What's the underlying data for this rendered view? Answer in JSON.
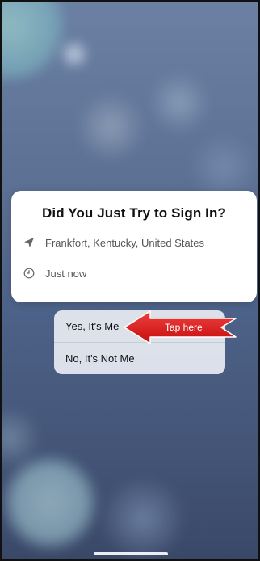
{
  "signin_prompt": {
    "title": "Did You Just Try to Sign In?",
    "location": {
      "icon": "location-arrow-icon",
      "text": "Frankfort, Kentucky, United States"
    },
    "time": {
      "icon": "clock-icon",
      "text": "Just now"
    }
  },
  "action_menu": {
    "items": [
      {
        "label": "Yes, It's Me"
      },
      {
        "label": "No, It's Not Me"
      }
    ]
  },
  "callout": {
    "text": "Tap here",
    "icon": "arrow-left-icon",
    "color": "#e01717"
  },
  "colors": {
    "card_background": "#ffffff",
    "menu_background": "#e2e6ee",
    "wallpaper_top": "#6b80a3",
    "wallpaper_bottom": "#3a4868"
  }
}
